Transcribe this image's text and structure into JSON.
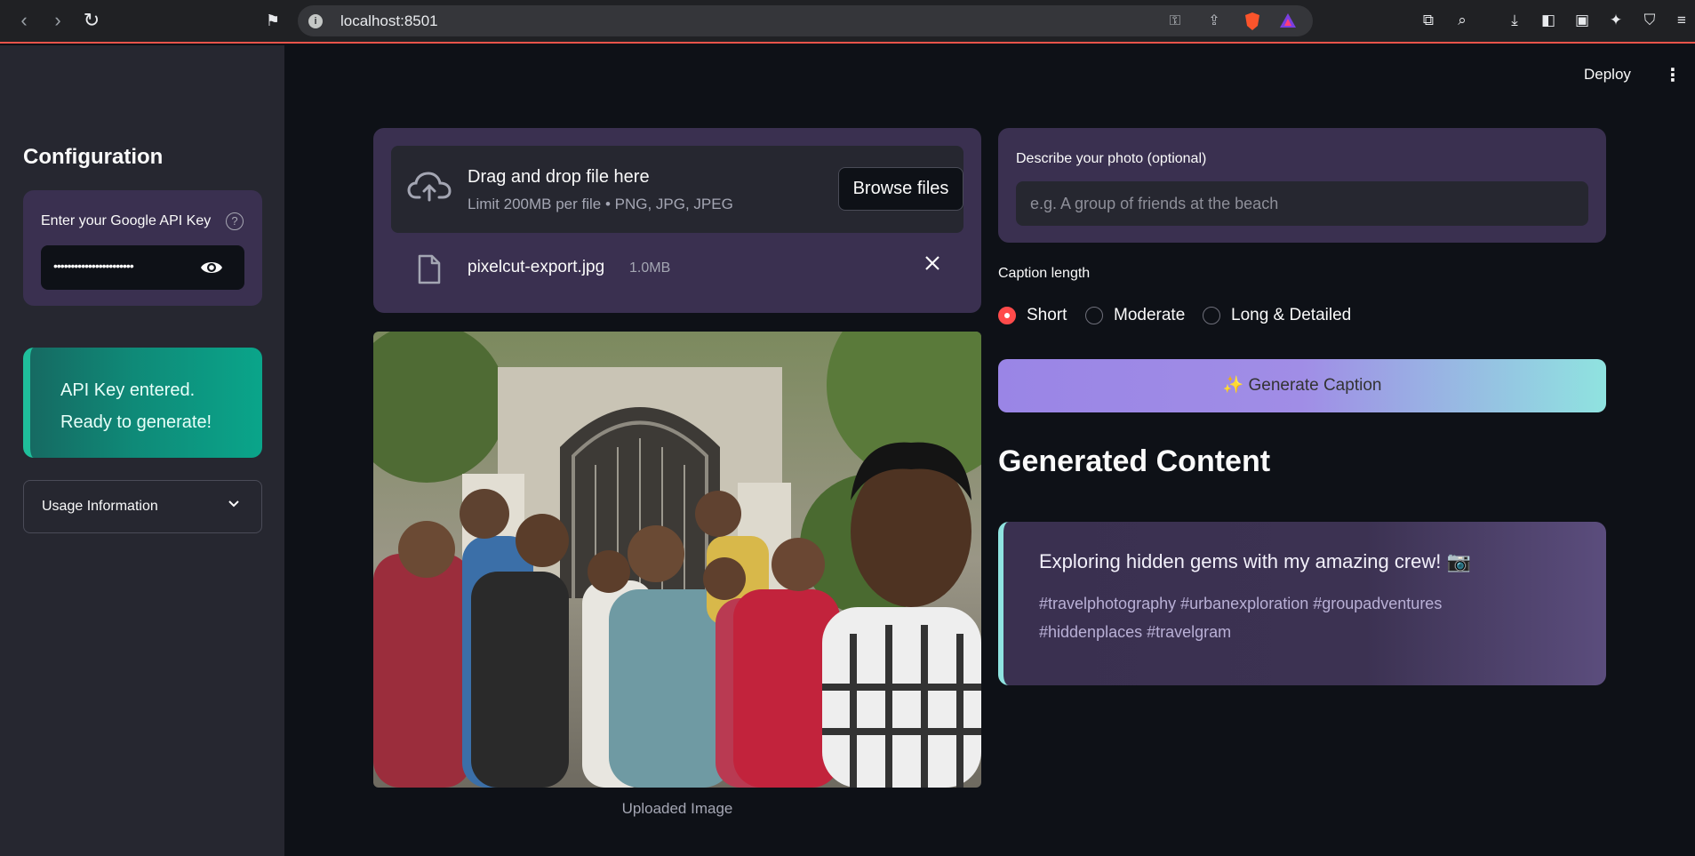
{
  "browser": {
    "url": "localhost:8501"
  },
  "header": {
    "deploy_label": "Deploy"
  },
  "sidebar": {
    "title": "Configuration",
    "api_key": {
      "label": "Enter your Google API Key",
      "masked_value": "•••••••••••••••••••••••"
    },
    "status": {
      "line1": "API Key entered.",
      "line2": "Ready to generate!"
    },
    "usage_label": "Usage Information"
  },
  "uploader": {
    "title": "Drag and drop file here",
    "subtitle": "Limit 200MB per file • PNG, JPG, JPEG",
    "browse_label": "Browse files",
    "file": {
      "name": "pixelcut-export.jpg",
      "size": "1.0MB"
    }
  },
  "image": {
    "caption": "Uploaded Image"
  },
  "describe": {
    "label": "Describe your photo (optional)",
    "placeholder": "e.g. A group of friends at the beach",
    "value": ""
  },
  "caption_length": {
    "label": "Caption length",
    "options": [
      "Short",
      "Moderate",
      "Long & Detailed"
    ],
    "selected": "Short"
  },
  "generate_label": "✨ Generate Caption",
  "generated": {
    "heading": "Generated Content",
    "caption": "Exploring hidden gems with my amazing crew! 📷",
    "hashtags": "#travelphotography #urbanexploration #groupadventures #hiddenplaces #travelgram"
  },
  "colors": {
    "app_bg": "#0e1117",
    "sidebar_bg": "#262730",
    "card_bg": "#3a3050",
    "accent_red": "#ff4b4b",
    "success_green": "#0aa58a",
    "gradient_start": "#9a85e6",
    "gradient_end": "#8fe3e0"
  }
}
